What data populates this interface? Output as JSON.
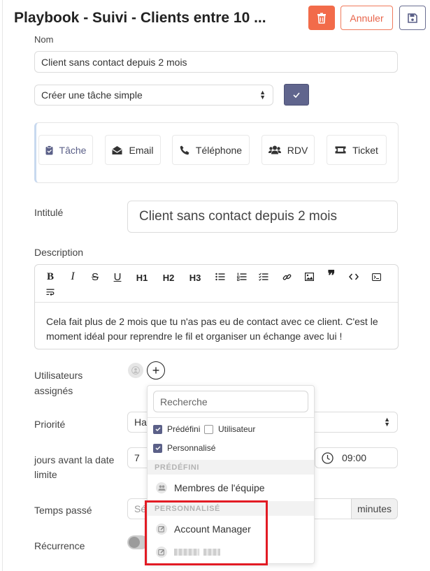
{
  "header": {
    "title": "Playbook - Suivi - Clients entre 10 ...",
    "cancel_label": "Annuler"
  },
  "form": {
    "nom_label": "Nom",
    "nom_value": "Client sans contact depuis 2 mois",
    "action_select": "Créer une tâche simple",
    "task_types": [
      {
        "label": "Tâche",
        "icon": "clipboard-check-icon",
        "active": true
      },
      {
        "label": "Email",
        "icon": "envelope-open-icon"
      },
      {
        "label": "Téléphone",
        "icon": "phone-icon"
      },
      {
        "label": "RDV",
        "icon": "users-icon"
      },
      {
        "label": "Ticket",
        "icon": "ticket-icon"
      }
    ],
    "intitule_label": "Intitulé",
    "intitule_value": "Client sans contact depuis 2 mois",
    "description_label": "Description",
    "toolbar": {
      "h1": "H1",
      "h2": "H2",
      "h3": "H3"
    },
    "description_text": "Cela fait plus de 2 mois que tu n'as pas eu de contact avec ce client. C'est le moment idéal pour reprendre le fil et organiser un échange avec lui !",
    "assigned_label": "Utilisateurs assignés",
    "priority_label": "Priorité",
    "priority_value": "Hau",
    "days_label": "jours avant la date limite",
    "days_value": "7",
    "time_value": "09:00",
    "time_spent_label": "Temps passé",
    "time_spent_placeholder": "Sél",
    "minutes_label": "minutes",
    "recurrence_label": "Récurrence"
  },
  "dropdown": {
    "search_placeholder": "Recherche",
    "filters": [
      {
        "label": "Prédéfini",
        "checked": true
      },
      {
        "label": "Utilisateur",
        "checked": false
      },
      {
        "label": "Personnalisé",
        "checked": true
      }
    ],
    "sections": [
      {
        "title": "PRÉDÉFINI",
        "items": [
          {
            "label": "Membres de l'équipe",
            "icon": "users-icon"
          }
        ]
      },
      {
        "title": "PERSONNALISÉ",
        "items": [
          {
            "label": "Account Manager",
            "icon": "edit-icon"
          },
          {
            "label": "",
            "icon": "edit-icon",
            "blurred": true
          }
        ]
      }
    ]
  },
  "colors": {
    "accent": "#60658d",
    "danger": "#f26b4a",
    "highlight": "#e21b24"
  }
}
